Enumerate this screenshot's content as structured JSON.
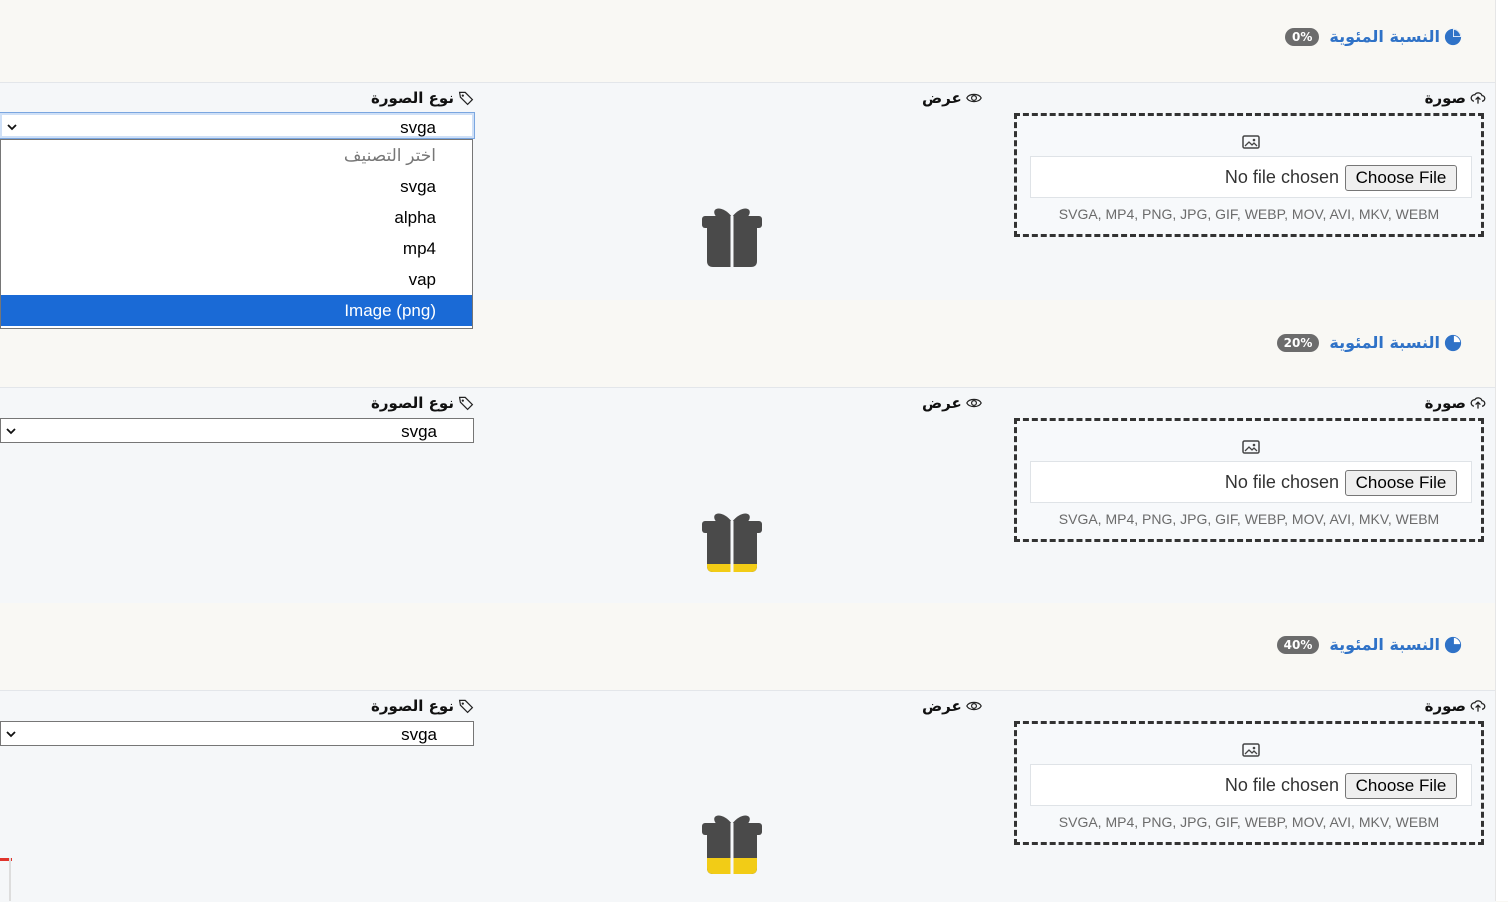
{
  "colors": {
    "accent": "#2f72c7",
    "badge_bg": "#6c6c6c",
    "selected_option": "#1a6ad6",
    "gift_body": "#4a4a4a",
    "gift_fill": "#f2cc16"
  },
  "sections": [
    {
      "title": "النسبة المئوية",
      "percent": "0%",
      "fill_fraction": 0,
      "image_label": "صورة",
      "preview_label": "عرض",
      "type_label": "نوع الصورة",
      "no_file": "No file chosen",
      "choose_file": "Choose File",
      "formats": "SVGA, MP4, PNG, JPG, GIF, WEBP, MOV, AVI, MKV, WEBM",
      "selected_type": "svga",
      "dropdown_open": true
    },
    {
      "title": "النسبة المئوية",
      "percent": "20%",
      "fill_fraction": 0.2,
      "image_label": "صورة",
      "preview_label": "عرض",
      "type_label": "نوع الصورة",
      "no_file": "No file chosen",
      "choose_file": "Choose File",
      "formats": "SVGA, MP4, PNG, JPG, GIF, WEBP, MOV, AVI, MKV, WEBM",
      "selected_type": "svga",
      "dropdown_open": false
    },
    {
      "title": "النسبة المئوية",
      "percent": "40%",
      "fill_fraction": 0.4,
      "image_label": "صورة",
      "preview_label": "عرض",
      "type_label": "نوع الصورة",
      "no_file": "No file chosen",
      "choose_file": "Choose File",
      "formats": "SVGA, MP4, PNG, JPG, GIF, WEBP, MOV, AVI, MKV, WEBM",
      "selected_type": "svga",
      "dropdown_open": false
    }
  ],
  "dropdown": {
    "options": [
      "اختر التصنيف",
      "svga",
      "alpha",
      "mp4",
      "vap",
      "Image (png)"
    ],
    "highlighted": "Image (png)"
  }
}
